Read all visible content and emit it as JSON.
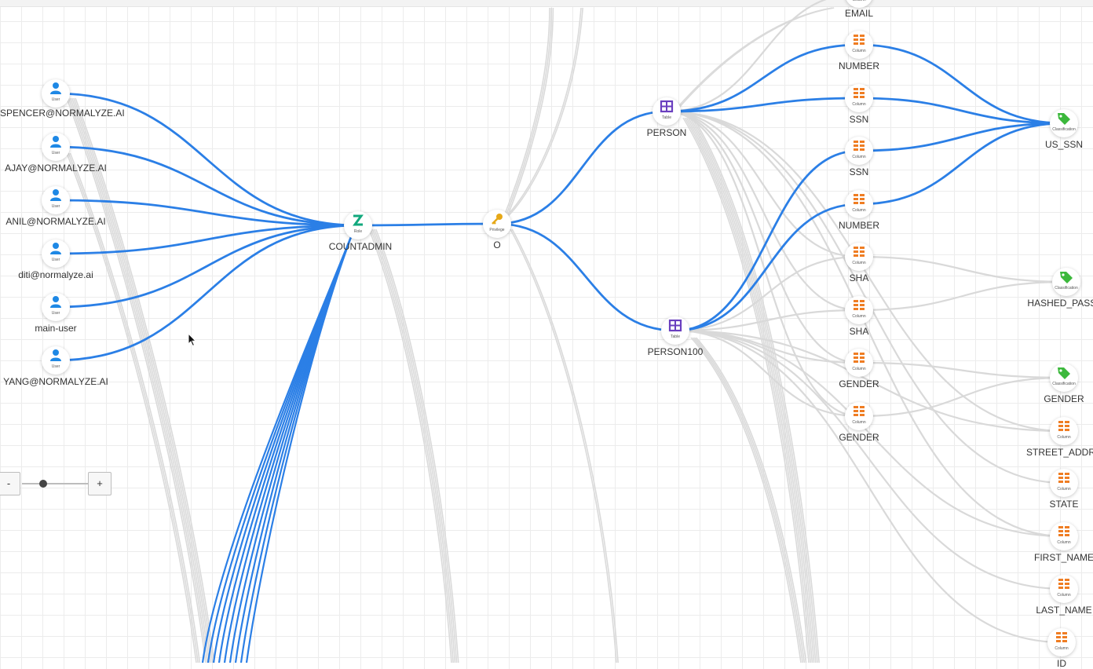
{
  "zoom": {
    "minus_label": "-",
    "plus_label": "+",
    "level": 0.32
  },
  "colors": {
    "highlight_edge": "#2b7fe6",
    "dim_edge": "#d9d9d9",
    "user_icon": "#1e88e5",
    "role_icon": "#12a87d",
    "privilege_icon": "#e6a817",
    "table_icon": "#6a3fbf",
    "column_icon": "#ef7d23",
    "classification_icon": "#3cb83c"
  },
  "nodes": [
    {
      "id": "u1",
      "type": "User",
      "label": "SPENCER@NORMALYZE.AI",
      "icon": "user-icon"
    },
    {
      "id": "u2",
      "type": "User",
      "label": "AJAY@NORMALYZE.AI",
      "icon": "user-icon"
    },
    {
      "id": "u3",
      "type": "User",
      "label": "ANIL@NORMALYZE.AI",
      "icon": "user-icon"
    },
    {
      "id": "u4",
      "type": "User",
      "label": "diti@normalyze.ai",
      "icon": "user-icon"
    },
    {
      "id": "u5",
      "type": "User",
      "label": "main-user",
      "icon": "user-icon"
    },
    {
      "id": "u6",
      "type": "User",
      "label": "YANG@NORMALYZE.AI",
      "icon": "user-icon"
    },
    {
      "id": "role",
      "type": "Role",
      "label": "COUNTADMIN",
      "icon": "role-icon"
    },
    {
      "id": "priv",
      "type": "Privilege",
      "label": "O",
      "icon": "key-icon"
    },
    {
      "id": "t1",
      "type": "Table",
      "label": "PERSON",
      "icon": "table-icon"
    },
    {
      "id": "t2",
      "type": "Table",
      "label": "PERSON100",
      "icon": "table-icon"
    },
    {
      "id": "c0",
      "type": "Column",
      "label": "EMAIL",
      "icon": "column-icon"
    },
    {
      "id": "c1",
      "type": "Column",
      "label": "NUMBER",
      "icon": "column-icon"
    },
    {
      "id": "c2",
      "type": "Column",
      "label": "SSN",
      "icon": "column-icon"
    },
    {
      "id": "c3",
      "type": "Column",
      "label": "SSN",
      "icon": "column-icon"
    },
    {
      "id": "c4",
      "type": "Column",
      "label": "NUMBER",
      "icon": "column-icon"
    },
    {
      "id": "c5",
      "type": "Column",
      "label": "SHA",
      "icon": "column-icon"
    },
    {
      "id": "c6",
      "type": "Column",
      "label": "SHA",
      "icon": "column-icon"
    },
    {
      "id": "c7",
      "type": "Column",
      "label": "GENDER",
      "icon": "column-icon"
    },
    {
      "id": "c8",
      "type": "Column",
      "label": "GENDER",
      "icon": "column-icon"
    },
    {
      "id": "k1",
      "type": "Classification",
      "label": "US_SSN",
      "icon": "tag-icon"
    },
    {
      "id": "k2",
      "type": "Classification",
      "label": "HASHED_PASSW",
      "icon": "tag-icon"
    },
    {
      "id": "k3",
      "type": "Classification",
      "label": "GENDER",
      "icon": "tag-icon"
    },
    {
      "id": "r1",
      "type": "Column",
      "label": "STREET_ADDRE",
      "icon": "column-icon"
    },
    {
      "id": "r2",
      "type": "Column",
      "label": "STATE",
      "icon": "column-icon"
    },
    {
      "id": "r3",
      "type": "Column",
      "label": "FIRST_NAME",
      "icon": "column-icon"
    },
    {
      "id": "r4",
      "type": "Column",
      "label": "LAST_NAME",
      "icon": "column-icon"
    },
    {
      "id": "r5",
      "type": "Column",
      "label": "ID",
      "icon": "column-icon"
    }
  ],
  "highlighted_edges": [
    [
      "u1",
      "role"
    ],
    [
      "u2",
      "role"
    ],
    [
      "u3",
      "role"
    ],
    [
      "u4",
      "role"
    ],
    [
      "u5",
      "role"
    ],
    [
      "u6",
      "role"
    ],
    [
      "role",
      "priv"
    ],
    [
      "priv",
      "t1"
    ],
    [
      "priv",
      "t2"
    ],
    [
      "t1",
      "c1"
    ],
    [
      "t1",
      "c2"
    ],
    [
      "t2",
      "c3"
    ],
    [
      "t2",
      "c4"
    ],
    [
      "c1",
      "k1"
    ],
    [
      "c2",
      "k1"
    ],
    [
      "c3",
      "k1"
    ],
    [
      "c4",
      "k1"
    ]
  ],
  "dim_edges": [
    [
      "t1",
      "c5"
    ],
    [
      "t1",
      "c6"
    ],
    [
      "t1",
      "c7"
    ],
    [
      "t1",
      "c8"
    ],
    [
      "t2",
      "c5"
    ],
    [
      "t2",
      "c6"
    ],
    [
      "t2",
      "c7"
    ],
    [
      "t2",
      "c8"
    ],
    [
      "c5",
      "k2"
    ],
    [
      "c6",
      "k2"
    ],
    [
      "c7",
      "k3"
    ],
    [
      "c8",
      "k3"
    ],
    [
      "t1",
      "r1"
    ],
    [
      "t1",
      "r2"
    ],
    [
      "t1",
      "r3"
    ],
    [
      "t2",
      "r1"
    ],
    [
      "t2",
      "r3"
    ],
    [
      "t2",
      "r4"
    ],
    [
      "t2",
      "r5"
    ],
    [
      "t1",
      "c0"
    ]
  ]
}
